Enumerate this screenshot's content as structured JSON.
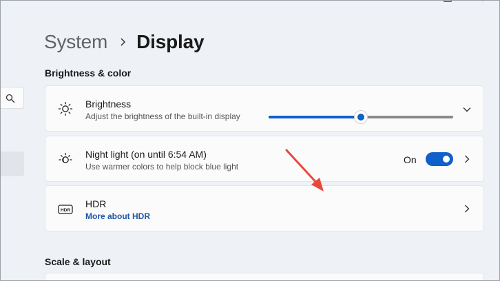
{
  "window": {
    "controls": [
      "maximize",
      "close"
    ]
  },
  "sidebar": {
    "search_icon": "search-icon"
  },
  "breadcrumb": {
    "parent": "System",
    "current": "Display"
  },
  "sections": {
    "brightness_color": "Brightness & color",
    "scale_layout": "Scale & layout"
  },
  "brightness": {
    "title": "Brightness",
    "subtitle": "Adjust the brightness of the built-in display",
    "level": 0.5,
    "icon": "sun-icon"
  },
  "night_light": {
    "title": "Night light (on until 6:54 AM)",
    "subtitle": "Use warmer colors to help block blue light",
    "toggle_label": "On",
    "toggle_on": true,
    "icon": "night-light-icon"
  },
  "hdr": {
    "title": "HDR",
    "link": "More about HDR",
    "icon": "hdr-icon"
  },
  "colors": {
    "accent": "#1060c9",
    "arrow": "#e8483a",
    "link": "#1f56a8"
  }
}
